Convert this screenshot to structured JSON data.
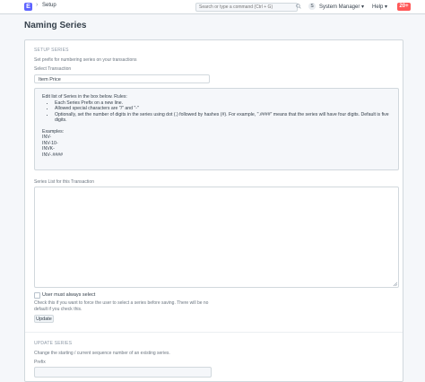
{
  "navbar": {
    "logo_letter": "E",
    "breadcrumb": "Setup",
    "search_placeholder": "Search or type a command (Ctrl + G)",
    "avatar_initial": "S",
    "user_menu": "System Manager ▾",
    "help_menu": "Help ▾",
    "notification_count": "20+"
  },
  "page_title": "Naming Series",
  "setup_series": {
    "heading": "SETUP SERIES",
    "description": "Set prefix for numbering series on your transactions",
    "select_label": "Select Transaction",
    "select_value": "Item Price",
    "help_intro": "Edit list of Series in the box below. Rules:",
    "rules": [
      "Each Series Prefix on a new line.",
      "Allowed special characters are \"/\" and \"-\"",
      "Optionally, set the number of digits in the series using dot (.) followed by hashes (#). For example, \".####\" means that the series will have four digits. Default is five digits."
    ],
    "examples_label": "Examples:",
    "examples": [
      "INV-",
      "INV-10-",
      "INVK-",
      "INV-.####"
    ],
    "list_label": "Series List for this Transaction",
    "checkbox_label": "User must always select",
    "checkbox_desc": "Check this if you want to force the user to select a series before saving. There will be no default if you check this.",
    "update_button": "Update"
  },
  "update_series": {
    "heading": "UPDATE SERIES",
    "description": "Change the starting / current sequence number of an existing series.",
    "prefix_label": "Prefix"
  }
}
